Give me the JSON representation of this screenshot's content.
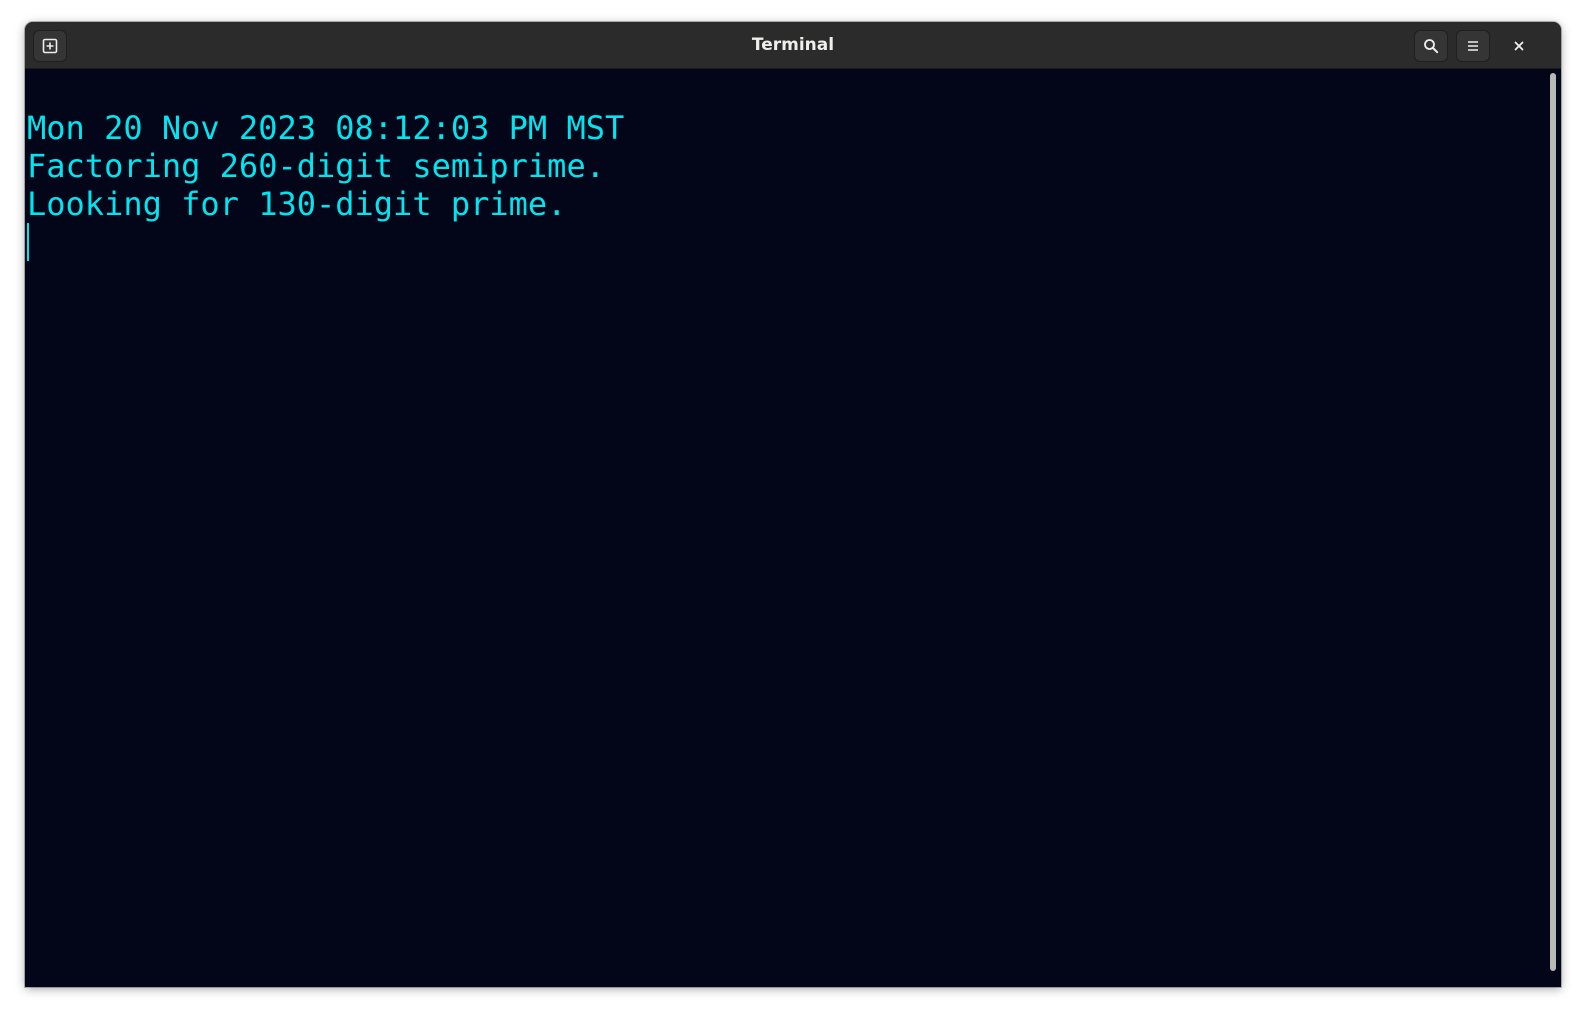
{
  "window": {
    "title": "Terminal"
  },
  "headerbar": {
    "new_tab_icon": "tab-new-icon",
    "search_icon": "search-icon",
    "menu_icon": "hamburger-menu-icon",
    "close_icon": "close-icon"
  },
  "terminal": {
    "lines": [
      "Mon 20 Nov 2023 08:12:03 PM MST",
      "Factoring 260-digit semiprime.",
      "Looking for 130-digit prime."
    ],
    "foreground_color": "#00e5f0",
    "background_color": "#020618"
  }
}
